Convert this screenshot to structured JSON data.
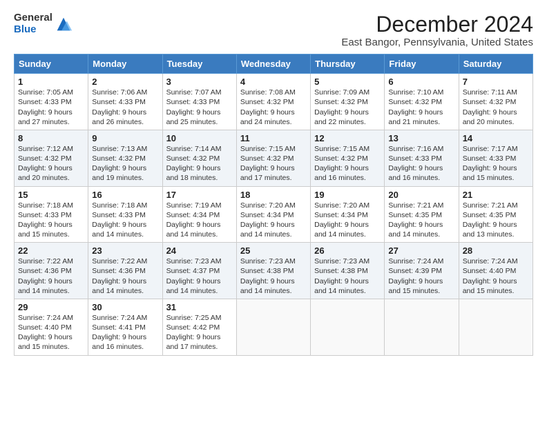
{
  "logo": {
    "general": "General",
    "blue": "Blue"
  },
  "header": {
    "title": "December 2024",
    "subtitle": "East Bangor, Pennsylvania, United States"
  },
  "weekdays": [
    "Sunday",
    "Monday",
    "Tuesday",
    "Wednesday",
    "Thursday",
    "Friday",
    "Saturday"
  ],
  "weeks": [
    [
      {
        "day": "1",
        "sunrise": "Sunrise: 7:05 AM",
        "sunset": "Sunset: 4:33 PM",
        "daylight": "Daylight: 9 hours and 27 minutes."
      },
      {
        "day": "2",
        "sunrise": "Sunrise: 7:06 AM",
        "sunset": "Sunset: 4:33 PM",
        "daylight": "Daylight: 9 hours and 26 minutes."
      },
      {
        "day": "3",
        "sunrise": "Sunrise: 7:07 AM",
        "sunset": "Sunset: 4:33 PM",
        "daylight": "Daylight: 9 hours and 25 minutes."
      },
      {
        "day": "4",
        "sunrise": "Sunrise: 7:08 AM",
        "sunset": "Sunset: 4:32 PM",
        "daylight": "Daylight: 9 hours and 24 minutes."
      },
      {
        "day": "5",
        "sunrise": "Sunrise: 7:09 AM",
        "sunset": "Sunset: 4:32 PM",
        "daylight": "Daylight: 9 hours and 22 minutes."
      },
      {
        "day": "6",
        "sunrise": "Sunrise: 7:10 AM",
        "sunset": "Sunset: 4:32 PM",
        "daylight": "Daylight: 9 hours and 21 minutes."
      },
      {
        "day": "7",
        "sunrise": "Sunrise: 7:11 AM",
        "sunset": "Sunset: 4:32 PM",
        "daylight": "Daylight: 9 hours and 20 minutes."
      }
    ],
    [
      {
        "day": "8",
        "sunrise": "Sunrise: 7:12 AM",
        "sunset": "Sunset: 4:32 PM",
        "daylight": "Daylight: 9 hours and 20 minutes."
      },
      {
        "day": "9",
        "sunrise": "Sunrise: 7:13 AM",
        "sunset": "Sunset: 4:32 PM",
        "daylight": "Daylight: 9 hours and 19 minutes."
      },
      {
        "day": "10",
        "sunrise": "Sunrise: 7:14 AM",
        "sunset": "Sunset: 4:32 PM",
        "daylight": "Daylight: 9 hours and 18 minutes."
      },
      {
        "day": "11",
        "sunrise": "Sunrise: 7:15 AM",
        "sunset": "Sunset: 4:32 PM",
        "daylight": "Daylight: 9 hours and 17 minutes."
      },
      {
        "day": "12",
        "sunrise": "Sunrise: 7:15 AM",
        "sunset": "Sunset: 4:32 PM",
        "daylight": "Daylight: 9 hours and 16 minutes."
      },
      {
        "day": "13",
        "sunrise": "Sunrise: 7:16 AM",
        "sunset": "Sunset: 4:33 PM",
        "daylight": "Daylight: 9 hours and 16 minutes."
      },
      {
        "day": "14",
        "sunrise": "Sunrise: 7:17 AM",
        "sunset": "Sunset: 4:33 PM",
        "daylight": "Daylight: 9 hours and 15 minutes."
      }
    ],
    [
      {
        "day": "15",
        "sunrise": "Sunrise: 7:18 AM",
        "sunset": "Sunset: 4:33 PM",
        "daylight": "Daylight: 9 hours and 15 minutes."
      },
      {
        "day": "16",
        "sunrise": "Sunrise: 7:18 AM",
        "sunset": "Sunset: 4:33 PM",
        "daylight": "Daylight: 9 hours and 14 minutes."
      },
      {
        "day": "17",
        "sunrise": "Sunrise: 7:19 AM",
        "sunset": "Sunset: 4:34 PM",
        "daylight": "Daylight: 9 hours and 14 minutes."
      },
      {
        "day": "18",
        "sunrise": "Sunrise: 7:20 AM",
        "sunset": "Sunset: 4:34 PM",
        "daylight": "Daylight: 9 hours and 14 minutes."
      },
      {
        "day": "19",
        "sunrise": "Sunrise: 7:20 AM",
        "sunset": "Sunset: 4:34 PM",
        "daylight": "Daylight: 9 hours and 14 minutes."
      },
      {
        "day": "20",
        "sunrise": "Sunrise: 7:21 AM",
        "sunset": "Sunset: 4:35 PM",
        "daylight": "Daylight: 9 hours and 14 minutes."
      },
      {
        "day": "21",
        "sunrise": "Sunrise: 7:21 AM",
        "sunset": "Sunset: 4:35 PM",
        "daylight": "Daylight: 9 hours and 13 minutes."
      }
    ],
    [
      {
        "day": "22",
        "sunrise": "Sunrise: 7:22 AM",
        "sunset": "Sunset: 4:36 PM",
        "daylight": "Daylight: 9 hours and 14 minutes."
      },
      {
        "day": "23",
        "sunrise": "Sunrise: 7:22 AM",
        "sunset": "Sunset: 4:36 PM",
        "daylight": "Daylight: 9 hours and 14 minutes."
      },
      {
        "day": "24",
        "sunrise": "Sunrise: 7:23 AM",
        "sunset": "Sunset: 4:37 PM",
        "daylight": "Daylight: 9 hours and 14 minutes."
      },
      {
        "day": "25",
        "sunrise": "Sunrise: 7:23 AM",
        "sunset": "Sunset: 4:38 PM",
        "daylight": "Daylight: 9 hours and 14 minutes."
      },
      {
        "day": "26",
        "sunrise": "Sunrise: 7:23 AM",
        "sunset": "Sunset: 4:38 PM",
        "daylight": "Daylight: 9 hours and 14 minutes."
      },
      {
        "day": "27",
        "sunrise": "Sunrise: 7:24 AM",
        "sunset": "Sunset: 4:39 PM",
        "daylight": "Daylight: 9 hours and 15 minutes."
      },
      {
        "day": "28",
        "sunrise": "Sunrise: 7:24 AM",
        "sunset": "Sunset: 4:40 PM",
        "daylight": "Daylight: 9 hours and 15 minutes."
      }
    ],
    [
      {
        "day": "29",
        "sunrise": "Sunrise: 7:24 AM",
        "sunset": "Sunset: 4:40 PM",
        "daylight": "Daylight: 9 hours and 15 minutes."
      },
      {
        "day": "30",
        "sunrise": "Sunrise: 7:24 AM",
        "sunset": "Sunset: 4:41 PM",
        "daylight": "Daylight: 9 hours and 16 minutes."
      },
      {
        "day": "31",
        "sunrise": "Sunrise: 7:25 AM",
        "sunset": "Sunset: 4:42 PM",
        "daylight": "Daylight: 9 hours and 17 minutes."
      },
      null,
      null,
      null,
      null
    ]
  ]
}
